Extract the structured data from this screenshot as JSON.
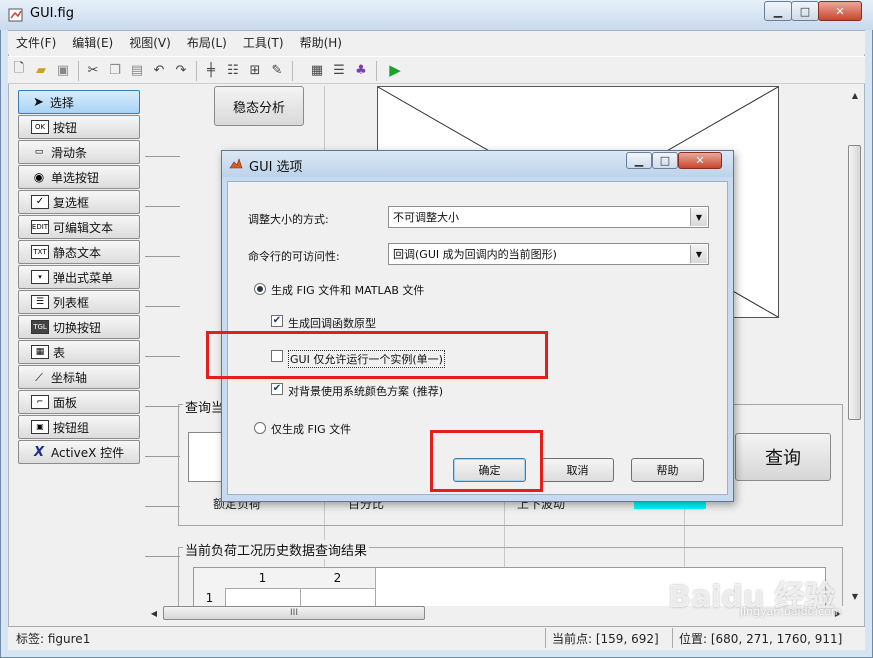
{
  "window": {
    "title": "GUI.fig"
  },
  "menu": [
    "文件(F)",
    "编辑(E)",
    "视图(V)",
    "布局(L)",
    "工具(T)",
    "帮助(H)"
  ],
  "palette": [
    {
      "label": "选择",
      "icon": "arrow-icon"
    },
    {
      "label": "按钮",
      "icon": "pushbutton-icon",
      "tag": "OK"
    },
    {
      "label": "滑动条",
      "icon": "slider-icon"
    },
    {
      "label": "单选按钮",
      "icon": "radio-icon"
    },
    {
      "label": "复选框",
      "icon": "checkbox-icon"
    },
    {
      "label": "可编辑文本",
      "icon": "edit-text-icon",
      "tag": "EDIT"
    },
    {
      "label": "静态文本",
      "icon": "static-text-icon",
      "tag": "TXT"
    },
    {
      "label": "弹出式菜单",
      "icon": "popup-icon"
    },
    {
      "label": "列表框",
      "icon": "listbox-icon"
    },
    {
      "label": "切换按钮",
      "icon": "toggle-icon",
      "tag": "TGL"
    },
    {
      "label": "表",
      "icon": "table-icon"
    },
    {
      "label": "坐标轴",
      "icon": "axes-icon"
    },
    {
      "label": "面板",
      "icon": "panel-icon"
    },
    {
      "label": "按钮组",
      "icon": "button-group-icon"
    },
    {
      "label": "ActiveX 控件",
      "icon": "activex-icon",
      "tag": "X"
    }
  ],
  "canvas": {
    "steady_button": "稳态分析",
    "query_panel_title": "查询当",
    "query_button": "查询",
    "bottom_labels": [
      "额定负荷",
      "百分比",
      "上下波动"
    ],
    "history_panel_title": "当前负荷工况历史数据查询结果",
    "table_headers": [
      "1",
      "2"
    ],
    "table_rows": [
      "1"
    ]
  },
  "dialog": {
    "title": "GUI 选项",
    "resize_label": "调整大小的方式:",
    "resize_value": "不可调整大小",
    "cmdline_label": "命令行的可访问性:",
    "cmdline_value": "回调(GUI 成为回调内的当前图形)",
    "radio_fig_matlab": "生成 FIG 文件和 MATLAB 文件",
    "check_callback": "生成回调函数原型",
    "check_single": "GUI 仅允许运行一个实例(单一)",
    "check_bgcolor": "对背景使用系统颜色方案 (推荐)",
    "radio_fig_only": "仅生成 FIG 文件",
    "ok": "确定",
    "cancel": "取消",
    "help": "帮助",
    "checked": {
      "callback": true,
      "single": false,
      "bgcolor": true
    },
    "selected_radio": "fig_matlab"
  },
  "status": {
    "tag": "标签: figure1",
    "point": "当前点:  [159, 692]",
    "position": "位置:  [680, 271, 1760, 911]"
  },
  "scroll_thumb_glyph": "III",
  "watermark": {
    "main": "Baidu 经验",
    "sub": "jingyan.baidu.com"
  },
  "colors": {
    "highlight_box": "#e41d1d",
    "cyan_bar": "#00ffff"
  }
}
